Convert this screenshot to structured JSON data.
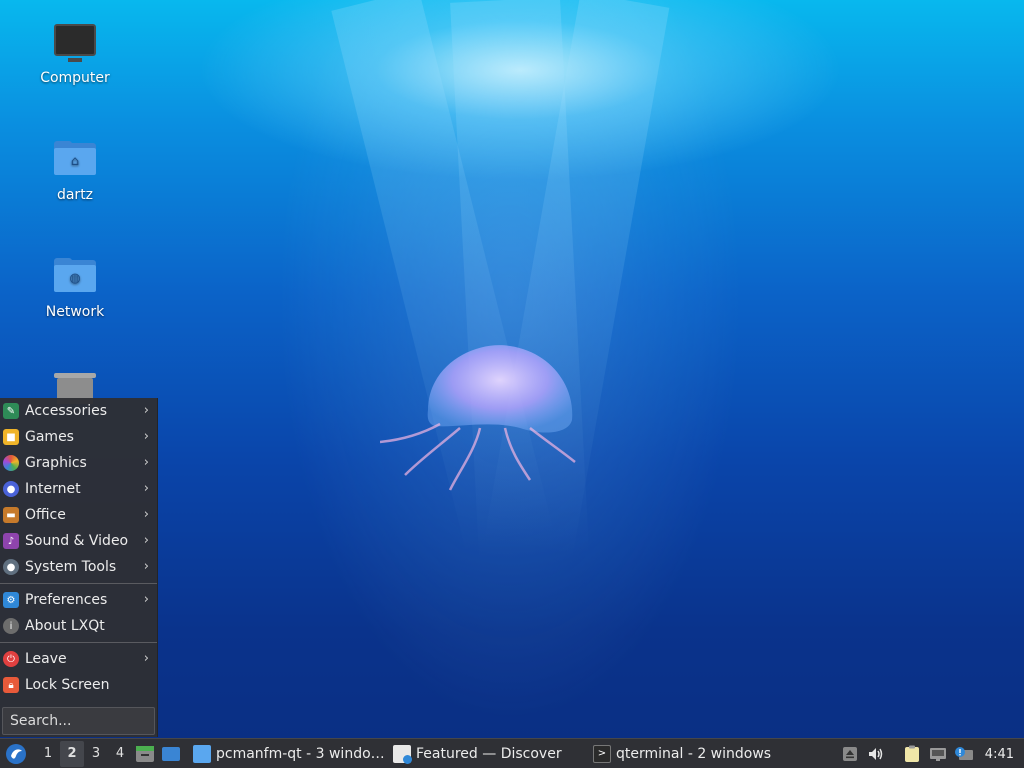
{
  "desktop": {
    "icons": [
      {
        "label": "Computer",
        "icon": "computer-icon"
      },
      {
        "label": "dartz",
        "icon": "home-folder-icon"
      },
      {
        "label": "Network",
        "icon": "network-folder-icon"
      },
      {
        "label": "",
        "icon": "trash-icon"
      }
    ]
  },
  "menu": {
    "items": [
      {
        "label": "Accessories",
        "icon": "accessories-icon",
        "submenu": true,
        "color": "#2e8b57"
      },
      {
        "label": "Games",
        "icon": "games-icon",
        "submenu": true,
        "color": "#f0b429"
      },
      {
        "label": "Graphics",
        "icon": "graphics-icon",
        "submenu": true,
        "color": "#e0553c"
      },
      {
        "label": "Internet",
        "icon": "internet-icon",
        "submenu": true,
        "color": "#4a62d8"
      },
      {
        "label": "Office",
        "icon": "office-icon",
        "submenu": true,
        "color": "#c67a2b"
      },
      {
        "label": "Sound & Video",
        "icon": "sound-video-icon",
        "submenu": true,
        "color": "#8e44ad"
      },
      {
        "label": "System Tools",
        "icon": "system-tools-icon",
        "submenu": true,
        "color": "#607080"
      },
      {
        "label": "Preferences",
        "icon": "preferences-icon",
        "submenu": true,
        "color": "#2f88d8"
      },
      {
        "label": "About LXQt",
        "icon": "info-icon",
        "submenu": false,
        "color": "#6d6d6d"
      },
      {
        "label": "Leave",
        "icon": "power-icon",
        "submenu": true,
        "color": "#e04040"
      },
      {
        "label": "Lock Screen",
        "icon": "lock-icon",
        "submenu": false,
        "color": "#e85a3a"
      }
    ],
    "search_placeholder": "Search..."
  },
  "taskbar": {
    "desktops": [
      "1",
      "2",
      "3",
      "4"
    ],
    "active_desktop": "2",
    "tasks": [
      {
        "label": "pcmanfm-qt - 3 windo…",
        "icon": "folder-icon"
      },
      {
        "label": "Featured — Discover",
        "icon": "discover-icon"
      },
      {
        "label": "qterminal - 2 windows",
        "icon": "terminal-icon"
      }
    ],
    "clock": "4:41"
  },
  "colors": {
    "panel": "#2f3035",
    "menu_bg": "#2e2f34",
    "accent": "#3a85d4"
  }
}
